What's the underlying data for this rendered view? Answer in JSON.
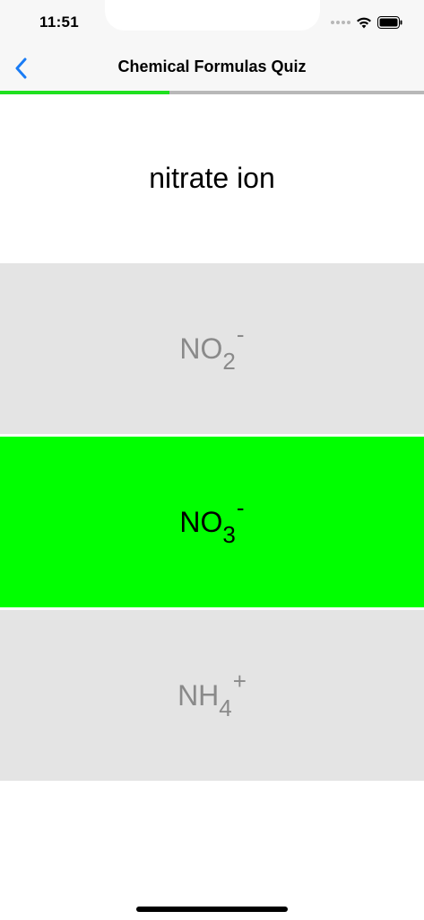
{
  "status_bar": {
    "time": "11:51",
    "icons": [
      "signal-icon",
      "wifi-icon",
      "battery-icon"
    ]
  },
  "nav": {
    "title": "Chemical Formulas Quiz",
    "back_icon": "chevron-left-icon"
  },
  "progress": {
    "fraction": 0.4,
    "fill_color": "#1fe01f",
    "track_color": "#b8b8b8"
  },
  "question": {
    "text": "nitrate ion"
  },
  "answers": [
    {
      "base": "NO",
      "subscript": "2",
      "superscript": "-",
      "state": "unselected"
    },
    {
      "base": "NO",
      "subscript": "3",
      "superscript": "-",
      "state": "correct"
    },
    {
      "base": "NH",
      "subscript": "4",
      "superscript": "+",
      "state": "unselected"
    }
  ],
  "colors": {
    "accent": "#1a7cf5",
    "correct": "#00ff00",
    "option_background": "#e4e4e4",
    "option_text": "#8a8a8a"
  }
}
